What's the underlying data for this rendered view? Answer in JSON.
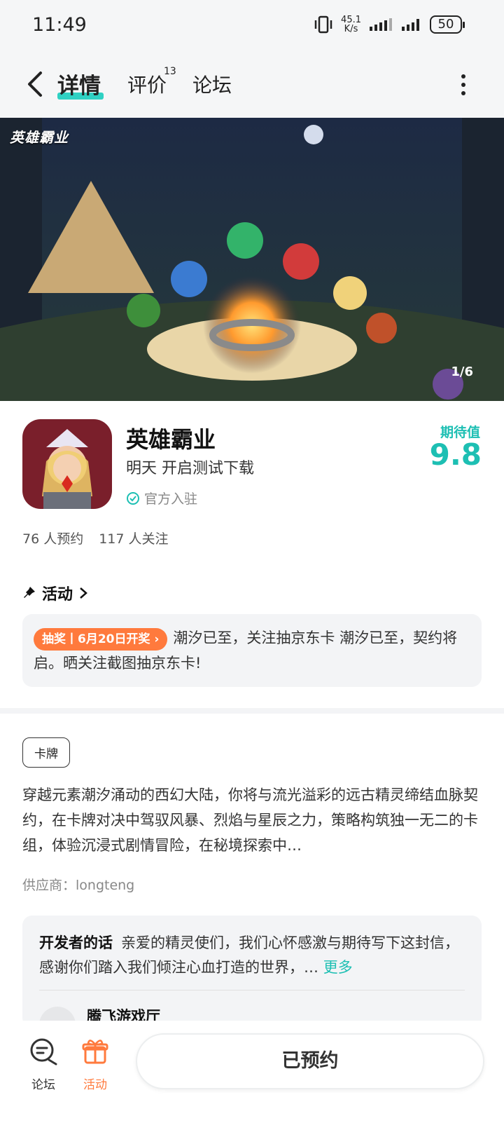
{
  "status_bar": {
    "time": "11:49",
    "net_speed_value": "45.1",
    "net_speed_unit": "K/s",
    "battery": "50"
  },
  "nav": {
    "tabs": [
      {
        "label": "详情",
        "active": true
      },
      {
        "label": "评价",
        "badge": "13"
      },
      {
        "label": "论坛"
      }
    ]
  },
  "banner": {
    "logo_text": "英雄霸业",
    "counter": "1/6"
  },
  "app": {
    "name": "英雄霸业",
    "release": "明天 开启测试下载",
    "official": "官方入驻",
    "expect_label": "期待值",
    "expect_value": "9.8"
  },
  "stats": {
    "reservations": "76 人预约",
    "followers": "117 人关注"
  },
  "activity": {
    "title": "活动",
    "pill": "抽奖丨6月20日开奖 ›",
    "text": "潮汐已至，关注抽京东卡 潮汐已至，契约将启。晒关注截图抽京东卡!"
  },
  "info": {
    "tag": "卡牌",
    "description": "穿越元素潮汐涌动的西幻大陆，你将与流光溢彩的远古精灵缔结血脉契约，在卡牌对决中驾驭风暴、烈焰与星辰之力，策略构筑独一无二的卡组，体验沉浸式剧情冒险，在秘境探索中…",
    "supplier": "供应商：longteng"
  },
  "developer": {
    "label": "开发者的话",
    "text": "亲爱的精灵使们，我们心怀感激与期待写下这封信，感谢你们踏入我们倾注心血打造的世界，…",
    "more": "更多",
    "author": "腾飞游戏厅"
  },
  "bottom_bar": {
    "forum_label": "论坛",
    "activity_label": "活动",
    "reserve_label": "已预约"
  },
  "colors": {
    "accent": "#1dbfb3",
    "orange": "#ff7a3d"
  }
}
